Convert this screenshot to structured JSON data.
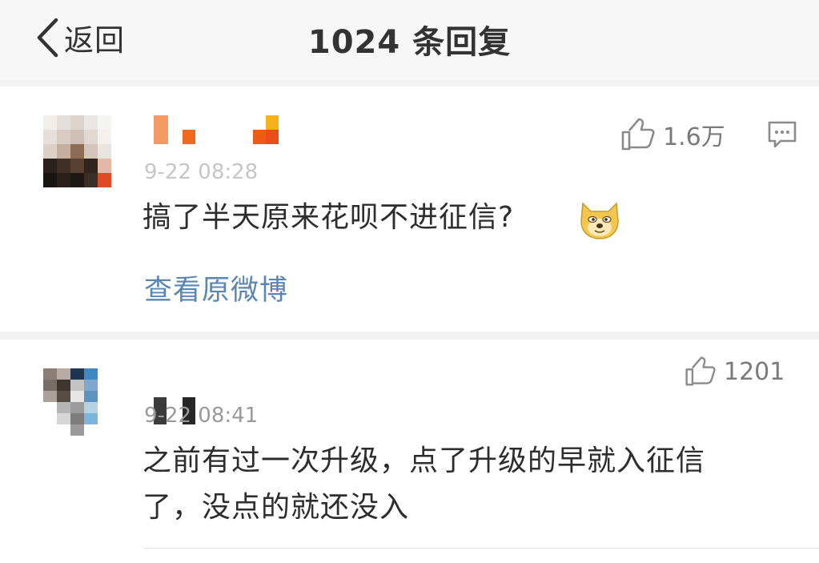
{
  "nav": {
    "back_label": "返回",
    "title": "1024 条回复"
  },
  "comments": [
    {
      "username": "",
      "time": "9-22 08:28",
      "text": "搞了半天原来花呗不进征信?",
      "emoji": "doge-emoji",
      "likes": "1.6万",
      "view_original": "查看原微博"
    },
    {
      "username": "",
      "time": "9-22 08:41",
      "text_lines": [
        "之前有过一次升级，点了升级的早就入征信",
        "了，没点的就还没入"
      ],
      "likes": "1201"
    }
  ],
  "icons": {
    "back": "chevron-left-icon",
    "like": "thumbs-up-icon",
    "comment": "comment-icon"
  },
  "colors": {
    "link": "#5a86b3",
    "text": "#2d2d2d",
    "muted": "#9a9a9a",
    "background": "#f2f2f2",
    "card": "#ffffff"
  }
}
